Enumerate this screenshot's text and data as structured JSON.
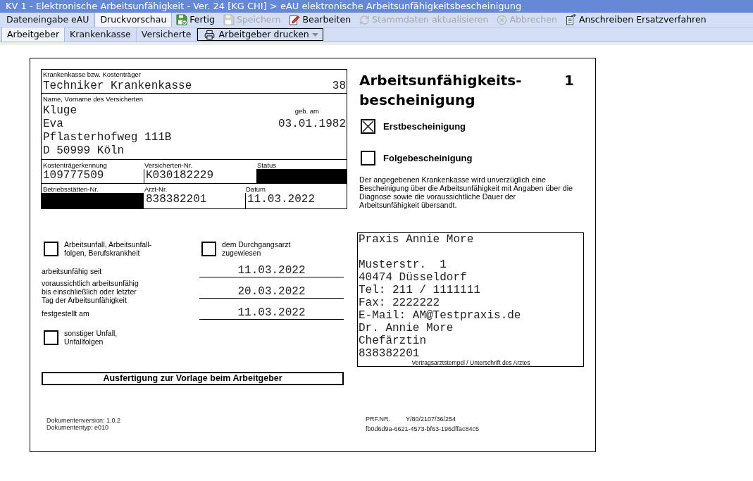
{
  "window": {
    "title": "KV 1 - Elektronische Arbeitsunfähigkeit - Ver. 24 [KG CHI] > eAU elektronische Arbeitsunfähigkeitsbescheinigung"
  },
  "main_tabs": [
    {
      "label": "Dateneingabe eAU",
      "selected": false
    },
    {
      "label": "Druckvorschau",
      "selected": true
    }
  ],
  "toolbar": [
    {
      "label": "Fertig",
      "kind": "done",
      "disabled": false
    },
    {
      "label": "Speichern",
      "kind": "save",
      "disabled": true
    },
    {
      "label": "Bearbeiten",
      "kind": "edit",
      "disabled": false
    },
    {
      "label": "Stammdaten aktualisieren",
      "kind": "refresh",
      "disabled": true
    },
    {
      "label": "Abbrechen",
      "kind": "cancel",
      "disabled": true
    },
    {
      "label": "Anschreiben Ersatzverfahren",
      "kind": "letter",
      "disabled": false
    }
  ],
  "sub_tabs": [
    {
      "label": "Arbeitgeber",
      "selected": true
    },
    {
      "label": "Krankenkasse",
      "selected": false
    },
    {
      "label": "Versicherte",
      "selected": false
    }
  ],
  "print_button": {
    "label": "Arbeitgeber drucken"
  },
  "form": {
    "insurance": {
      "label": "Krankenkasse bzw. Kostenträger",
      "name": "Techniker Krankenkasse",
      "number": "38"
    },
    "insured": {
      "label": "Name, Vorname des Versicherten",
      "surname": "Kluge",
      "birth_label": "geb. am",
      "first_name": "Eva",
      "birth_date": "03.01.1982",
      "street": "Pflasterhofweg 111B",
      "city": "D 50999 Köln"
    },
    "id_fields": [
      {
        "label": "Kostenträgerkennung",
        "value": "109777509",
        "redacted": false
      },
      {
        "label": "Versicherten-Nr.",
        "value": "K030182229",
        "redacted": false
      },
      {
        "label": "Status",
        "redacted": true
      }
    ],
    "practice_fields": [
      {
        "label": "Betriebsstätten-Nr.",
        "redacted": true
      },
      {
        "label": "Arzt-Nr.",
        "value": "838382201",
        "redacted": false
      },
      {
        "label": "Datum",
        "value": "11.03.2022",
        "redacted": false
      }
    ],
    "title": "Arbeitsunfähigkeits-bescheinigung",
    "copy_number": "1",
    "certificate_types": [
      {
        "label": "Erstbescheinigung",
        "checked": true
      },
      {
        "label": "Folgebescheinigung",
        "checked": false
      }
    ],
    "notice": "Der angegebenen Krankenkasse wird unverzüglich eine Bescheinigung über die Arbeitsunfähigkeit mit Angaben über die Diagnose sowie die voraussichtliche Dauer der Arbeitsunfähigkeit übersandt.",
    "accident_checks": [
      {
        "label": "Arbeitsunfall, Arbeitsunfall-folgen, Berufskrankheit",
        "checked": false
      },
      {
        "label": "dem Durchgangsarzt zugewiesen",
        "checked": false
      }
    ],
    "date_rows": [
      {
        "label": "arbeitsunfähig seit",
        "value": "11.03.2022"
      },
      {
        "label": "voraussichtlich arbeitsunfähig bis einschließlich oder letzter Tag der Arbeitsunfähigkeit",
        "value": "20.03.2022"
      },
      {
        "label": "festgestellt am",
        "value": "11.03.2022"
      }
    ],
    "other_accident": {
      "label": "sonstiger Unfall, Unfallfolgen",
      "checked": false
    },
    "copy_label": "Ausfertigung zur Vorlage beim Arbeitgeber",
    "stamp": {
      "name": "Praxis Annie More",
      "lines": [
        "Musterstr.  1",
        "40474 Düsseldorf",
        "Tel: 211 / 1111111",
        "Fax: 2222222",
        "E-Mail: AM@Testpraxis.de",
        "Dr. Annie More",
        "Chefärztin",
        "838382201"
      ],
      "caption": "Vertragsarztstempel / Unterschrift des Arztes"
    },
    "document_info": [
      "Dokumentenversion: 1.0.2",
      "Dokumententyp: e010"
    ],
    "prf": {
      "label": "PRF.NR.",
      "value": "Y/80/2107/36/254"
    },
    "document_id": "fb0d6d9a-6621-4573-bf63-196dffac84c5"
  }
}
